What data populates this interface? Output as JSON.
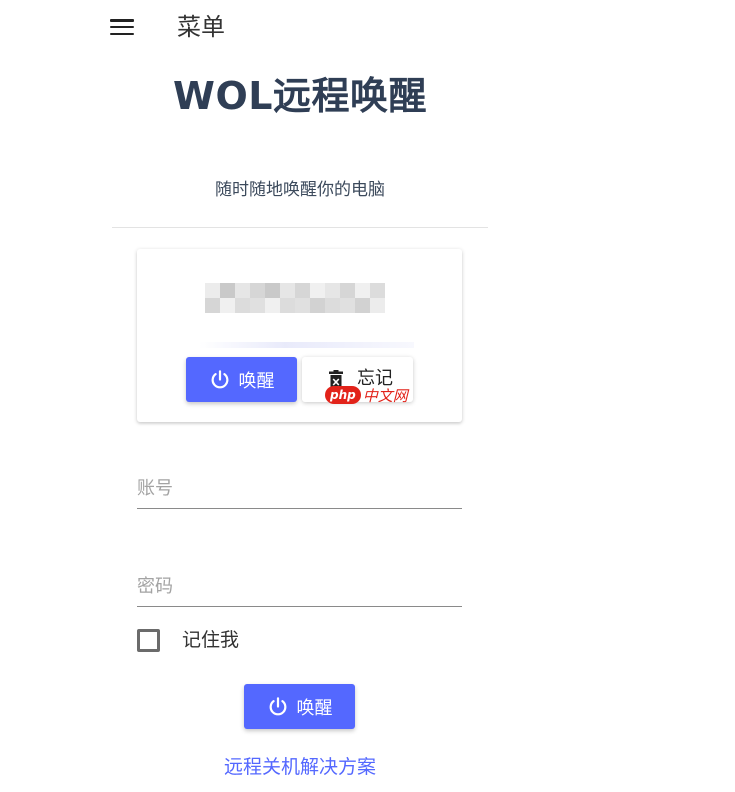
{
  "header": {
    "menu_label": "菜单"
  },
  "title": "WOL远程唤醒",
  "subtitle": "随时随地唤醒你的电脑",
  "device_card": {
    "wake_label": "唤醒",
    "forget_label": "忘记",
    "watermark": {
      "badge": "php",
      "text": "中文网"
    }
  },
  "form": {
    "account_placeholder": "账号",
    "password_placeholder": "密码",
    "remember_label": "记住我",
    "wake_label": "唤醒"
  },
  "link_text": "远程关机解决方案",
  "colors": {
    "accent": "#5468ff",
    "title": "#2f3e55",
    "watermark": "#e2231a"
  },
  "icons": {
    "menu": "hamburger-menu-icon",
    "power": "power-icon",
    "trash": "trash-icon"
  }
}
